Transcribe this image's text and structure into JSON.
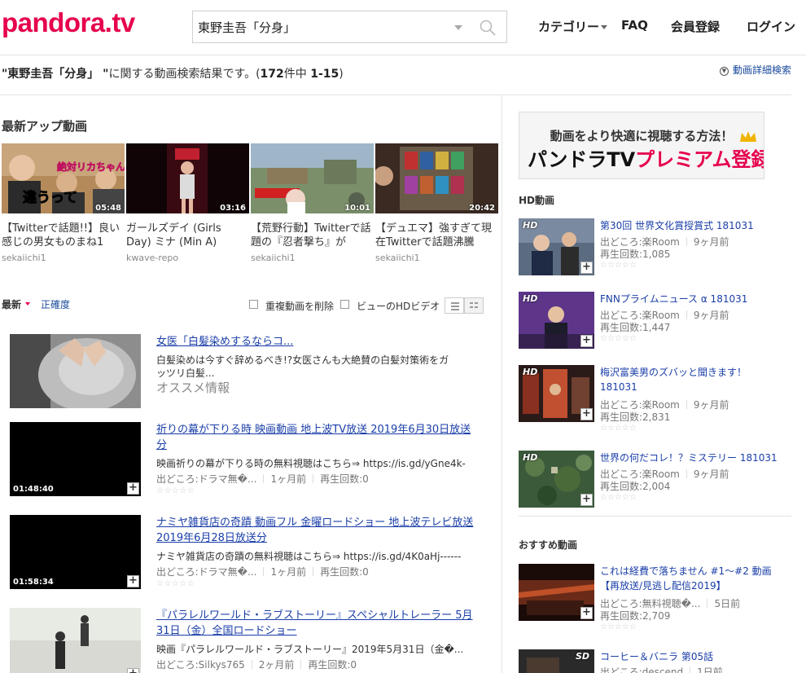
{
  "header": {
    "logo": "pandora.tv",
    "search_value": "東野圭吾「分身」",
    "nav_category": "カテゴリー",
    "nav_faq": "FAQ",
    "nav_register": "会員登録",
    "nav_login": "ログイン"
  },
  "results": {
    "query": "\"東野圭吾「分身」 \"",
    "text": "に関する動画検索結果です。",
    "count_prefix": "(",
    "count": "172",
    "count_mid": "件中 ",
    "range": "1-15",
    "count_suffix": ")",
    "advanced": "動画詳細検索"
  },
  "latest": {
    "heading": "最新アップ動画",
    "items": [
      {
        "duration": "05:48",
        "title": "【Twitterで話題!!】良い感じの男女ものまね1",
        "user": "sekaiichi1",
        "caption_top": "絶対リカちゃん",
        "caption_bottom": "違うって"
      },
      {
        "duration": "03:16",
        "title": "ガールズデイ (Girls Day) ミナ (Min A)",
        "user": "kwave-repo"
      },
      {
        "duration": "10:01",
        "title": "【荒野行動】Twitterで話題の『忍者撃ち』が",
        "user": "sekaiichi1"
      },
      {
        "duration": "20:42",
        "title": "【デュエマ】強すぎて現在Twitterで話題沸騰",
        "user": "sekaiichi1"
      }
    ]
  },
  "sort": {
    "latest": "最新",
    "accuracy": "正確度",
    "remove_dup": "重複動画を削除",
    "hd_only": "ビューのHDビデオ"
  },
  "videos": [
    {
      "title": "女医「白髪染めするならコ...",
      "desc": "白髪染めは今すぐ辞めるべき!?女医さんも大絶賛の白髪対策術をガッツリ白髪...",
      "ad_label": "オススメ情報"
    },
    {
      "title": "祈りの幕が下りる時 映画動画 地上波TV放送 2019年6月30日放送分",
      "desc": "映画祈りの幕が下りる時の無料視聴はこちら⇒ https://is.gd/yGne4k-",
      "duration": "01:48:40",
      "source": "出どころ:ドラマ無�...",
      "ago": "1ヶ月前",
      "plays": "再生回数:0",
      "stars": "☆☆☆☆☆"
    },
    {
      "title": "ナミヤ雑貨店の奇蹟 動画フル 金曜ロードショー 地上波テレビ放送 2019年6月28日放送分",
      "desc": "ナミヤ雑貨店の奇蹟の無料視聴はこちら⇒ https://is.gd/4K0aHj------",
      "duration": "01:58:34",
      "source": "出どころ:ドラマ無�...",
      "ago": "1ヶ月前",
      "plays": "再生回数:0",
      "stars": "☆☆☆☆☆"
    },
    {
      "title": "『パラレルワールド・ラブストーリー』スペシャルトレーラー 5月31日（金）全国ロードショー",
      "desc": "映画『パラレルワールド・ラブストーリー』2019年5月31日（金�...",
      "source": "出どころ:Silkys765",
      "ago": "2ヶ月前",
      "plays": "再生回数:0"
    }
  ],
  "right": {
    "premium_line1": "動画をより快適に視聴する方法！",
    "premium_line2_a": "パンドラTV",
    "premium_line2_b": "プレミアム登録",
    "hd_heading": "HD動画",
    "hd_badge": "HD",
    "sd_badge": "SD",
    "hd_items": [
      {
        "title": "第30回 世界文化賞授賞式 181031",
        "source": "出どころ:楽Room",
        "ago": "9ヶ月前",
        "plays": "再生回数:1,085",
        "stars": "☆☆☆☆☆"
      },
      {
        "title": "FNNプライムニュース α 181031",
        "source": "出どころ:楽Room",
        "ago": "9ヶ月前",
        "plays": "再生回数:1,447",
        "stars": "☆☆☆☆☆"
      },
      {
        "title": "梅沢富美男のズバッと聞きます！ 181031",
        "source": "出どころ:楽Room",
        "ago": "9ヶ月前",
        "plays": "再生回数:2,831",
        "stars": "☆☆☆☆☆"
      },
      {
        "title": "世界の何だコレ！？ミステリー 181031",
        "source": "出どころ:楽Room",
        "ago": "9ヶ月前",
        "plays": "再生回数:2,004",
        "stars": "☆☆☆☆☆"
      }
    ],
    "rec_heading": "おすすめ動画",
    "rec_items": [
      {
        "title": "これは経費で落ちません #1～#2 動画【再放送/見逃し配信2019】",
        "source": "出どころ:無料視聴�...",
        "ago": "5日前",
        "plays": "再生回数:2,709",
        "stars": "☆☆☆☆☆"
      },
      {
        "title": "コーヒー＆バニラ 第05話",
        "source": "出どころ:descend",
        "ago": "1日前"
      }
    ]
  }
}
